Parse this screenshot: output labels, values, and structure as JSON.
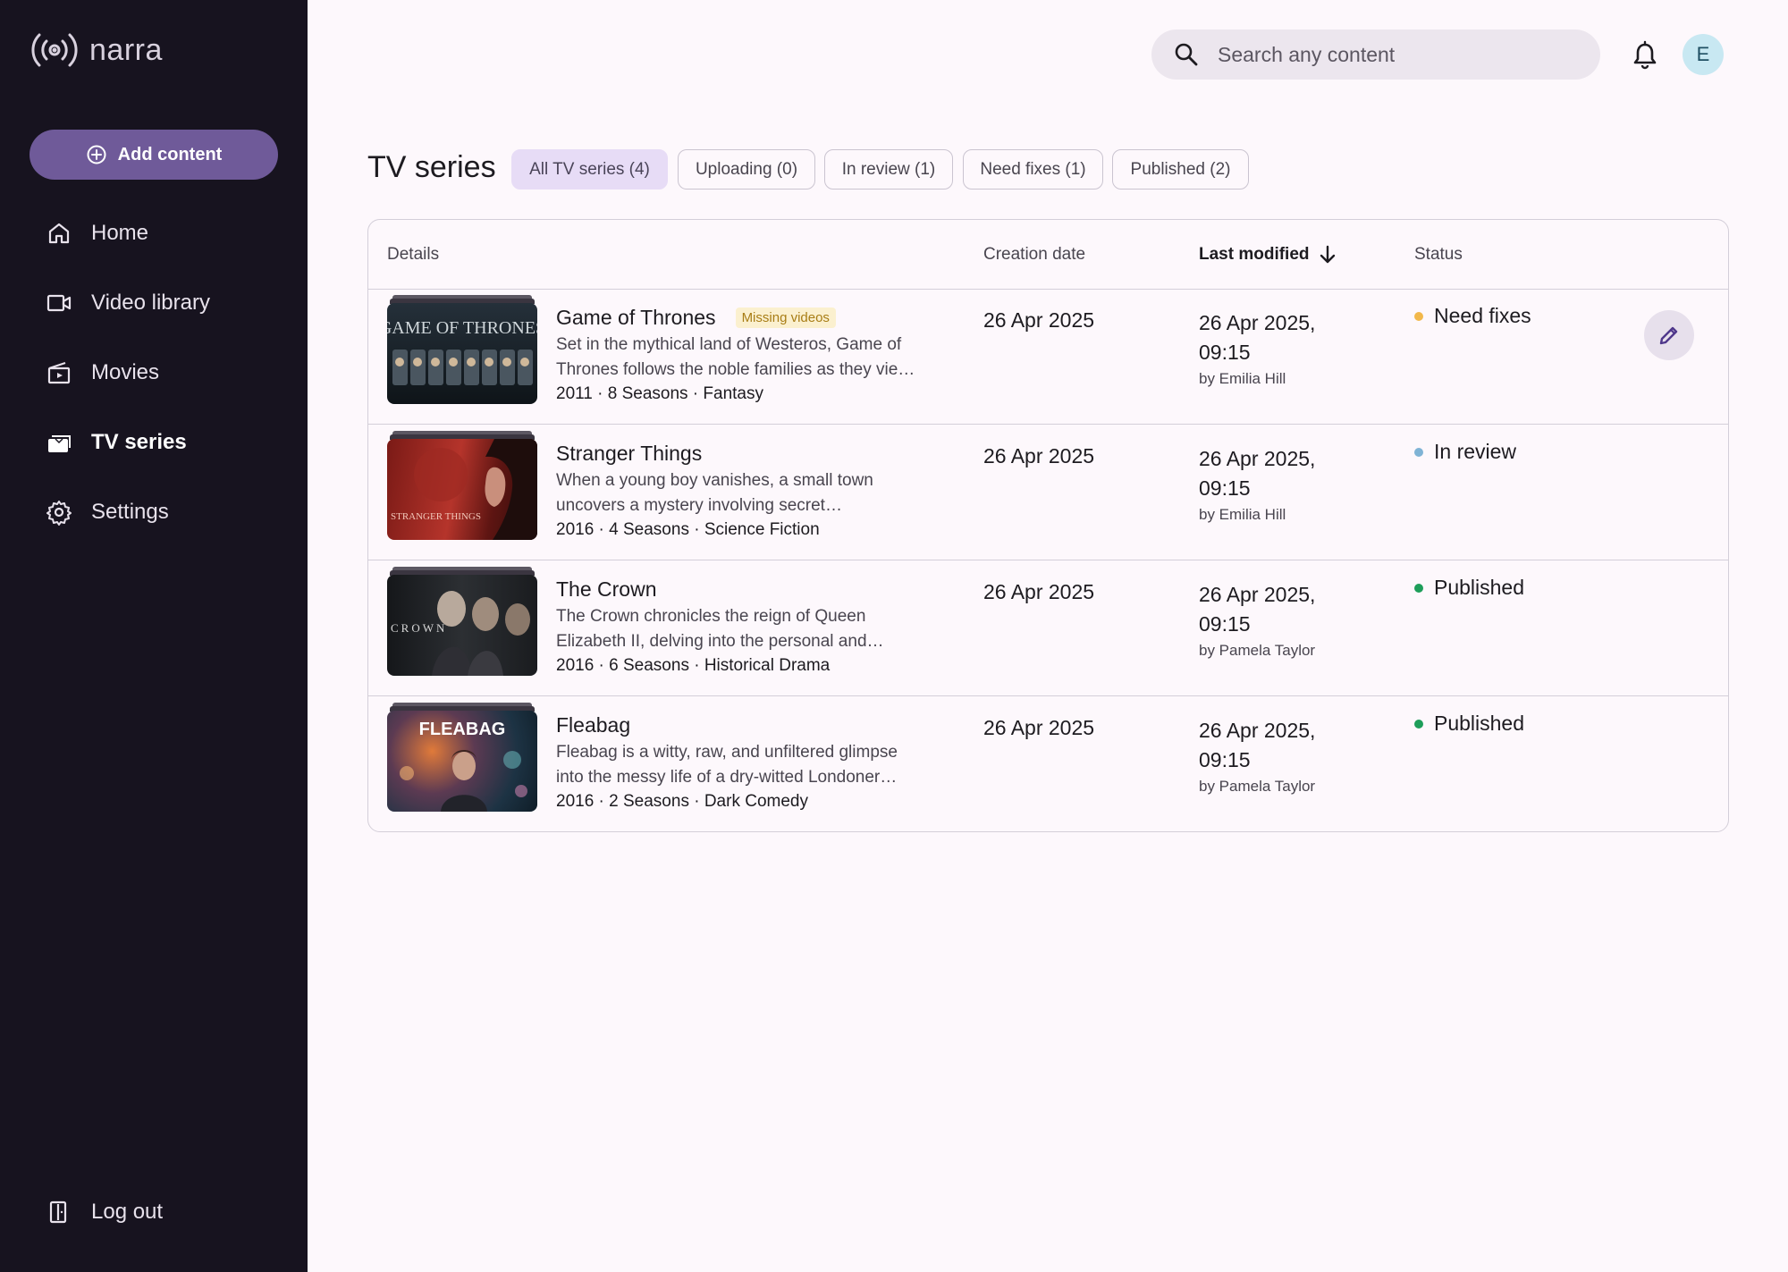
{
  "app": {
    "name": "narra"
  },
  "sidebar": {
    "add_label": "Add content",
    "items": [
      {
        "label": "Home",
        "icon": "home-icon"
      },
      {
        "label": "Video library",
        "icon": "video-camera-icon"
      },
      {
        "label": "Movies",
        "icon": "clapperboard-icon"
      },
      {
        "label": "TV series",
        "icon": "tv-stack-icon"
      },
      {
        "label": "Settings",
        "icon": "gear-icon"
      }
    ],
    "logout_label": "Log out"
  },
  "header": {
    "search_placeholder": "Search any content",
    "avatar_initial": "E"
  },
  "page": {
    "title": "TV series",
    "filters": [
      {
        "label": "All TV series (4)",
        "active": true
      },
      {
        "label": "Uploading (0)",
        "active": false
      },
      {
        "label": "In review (1)",
        "active": false
      },
      {
        "label": "Need fixes (1)",
        "active": false
      },
      {
        "label": "Published (2)",
        "active": false
      }
    ]
  },
  "table": {
    "columns": {
      "details": "Details",
      "creation": "Creation date",
      "modified": "Last modified",
      "status": "Status"
    },
    "rows": [
      {
        "title": "Game of Thrones",
        "badge": "Missing videos",
        "desc1": "Set in the mythical land of Westeros, Game of",
        "desc2": "Thrones follows the noble families as they vie…",
        "meta": "2011 · 8 Seasons · Fantasy",
        "creation": "26 Apr 2025",
        "modified1": "26 Apr 2025,",
        "modified2": "09:15",
        "by": "by Emilia Hill",
        "status": "Need fixes",
        "status_color": "#f2b84b",
        "thumb_text": "GAME OF THRONES"
      },
      {
        "title": "Stranger Things",
        "badge": "",
        "desc1": "When a young boy vanishes, a small town",
        "desc2": "uncovers a mystery involving secret…",
        "meta": "2016 · 4 Seasons · Science Fiction",
        "creation": "26 Apr 2025",
        "modified1": "26 Apr 2025,",
        "modified2": "09:15",
        "by": "by Emilia Hill",
        "status": "In review",
        "status_color": "#7fb3d5",
        "thumb_text": "STRANGER THINGS"
      },
      {
        "title": "The Crown",
        "badge": "",
        "desc1": "The Crown chronicles the reign of Queen",
        "desc2": "Elizabeth II, delving into the personal and…",
        "meta": "2016 · 6 Seasons · Historical Drama",
        "creation": "26 Apr 2025",
        "modified1": "26 Apr 2025,",
        "modified2": "09:15",
        "by": "by Pamela Taylor",
        "status": "Published",
        "status_color": "#1e9e5a",
        "thumb_text": "CROWN"
      },
      {
        "title": "Fleabag",
        "badge": "",
        "desc1": "Fleabag is a witty, raw, and unfiltered glimpse",
        "desc2": "into the messy life of a dry-witted Londoner…",
        "meta": "2016 · 2 Seasons · Dark Comedy",
        "creation": "26 Apr 2025",
        "modified1": "26 Apr 2025,",
        "modified2": "09:15",
        "by": "by Pamela Taylor",
        "status": "Published",
        "status_color": "#1e9e5a",
        "thumb_text": "FLEABAG"
      }
    ]
  },
  "colors": {
    "sidebar_bg": "#17131f",
    "accent": "#6f5a99",
    "page_bg": "#fdf8fc"
  }
}
